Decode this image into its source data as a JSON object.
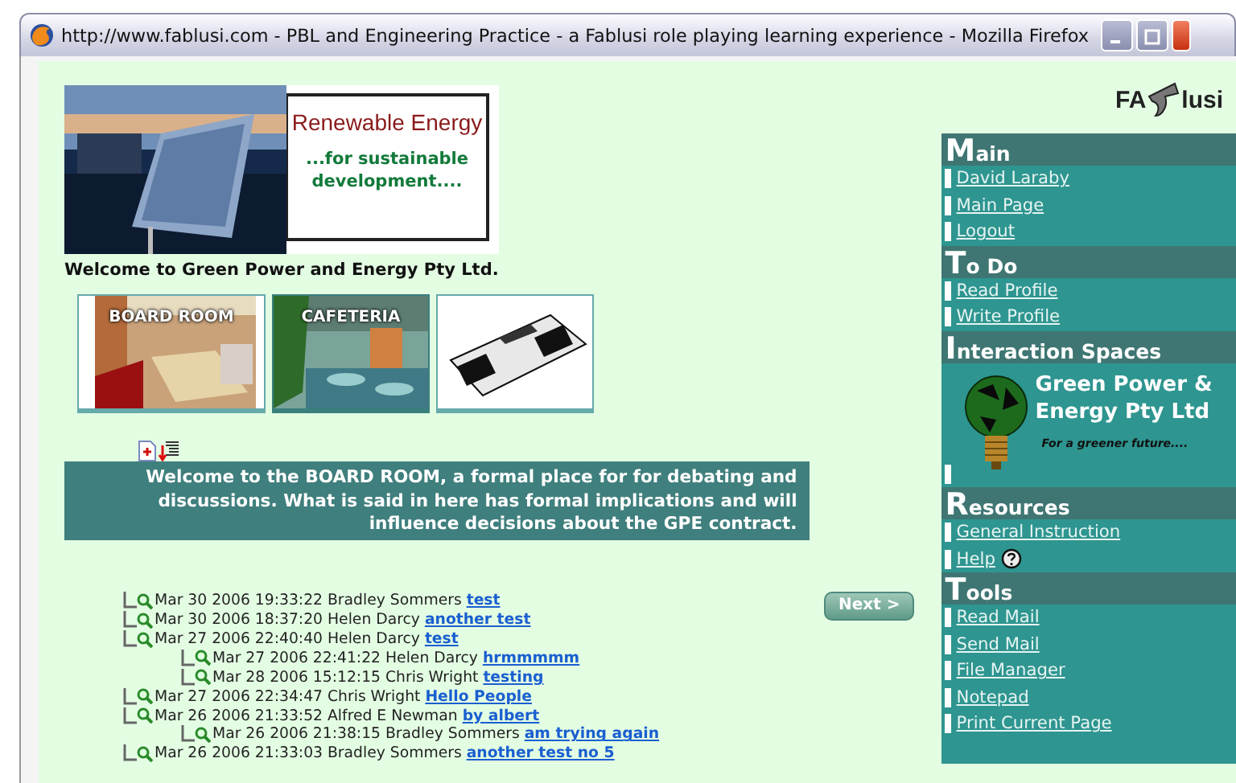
{
  "window": {
    "title": "http://www.fablusi.com - PBL and Engineering Practice - a Fablusi role playing learning experience - Mozilla Firefox"
  },
  "logo": {
    "left": "FA",
    "right": "lusi"
  },
  "banner": {
    "title": "Renewable Energy",
    "subtitle": "...for sustainable development...."
  },
  "welcome": "Welcome to Green Power and Energy Pty Ltd.",
  "rooms": [
    {
      "kind": "boardroom",
      "label": "BOARD ROOM",
      "selected": false
    },
    {
      "kind": "cafeteria",
      "label": "CAFETERIA",
      "selected": true
    },
    {
      "kind": "news",
      "selected": false
    }
  ],
  "room_description": "Welcome to the BOARD ROOM, a formal place for for debating and discussions. What is said in here has formal implications and will influence decisions about the GPE contract.",
  "next_button": "Next >",
  "posts": [
    {
      "date": "Mar 30 2006 19:33:22",
      "author": "Bradley Sommers",
      "subject": "test"
    },
    {
      "date": "Mar 30 2006 18:37:20",
      "author": "Helen Darcy",
      "subject": "another test"
    },
    {
      "date": "Mar 27 2006 22:40:40",
      "author": "Helen Darcy",
      "subject": "test",
      "children": [
        {
          "date": "Mar 27 2006 22:41:22",
          "author": "Helen Darcy",
          "subject": "hrmmmmm"
        },
        {
          "date": "Mar 28 2006 15:12:15",
          "author": "Chris Wright",
          "subject": "testing"
        }
      ]
    },
    {
      "date": "Mar 27 2006 22:34:47",
      "author": "Chris Wright",
      "subject": "Hello People"
    },
    {
      "date": "Mar 26 2006 21:33:52",
      "author": "Alfred E Newman",
      "subject": "by albert",
      "children": [
        {
          "date": "Mar 26 2006 21:38:15",
          "author": "Bradley Sommers",
          "subject": "am trying again"
        }
      ]
    },
    {
      "date": "Mar 26 2006 21:33:03",
      "author": "Bradley Sommers",
      "subject": "another test no 5"
    }
  ],
  "sidebar": [
    {
      "heading": "Main",
      "items": [
        {
          "label": "David Laraby"
        },
        {
          "label": "Main Page"
        },
        {
          "label": "Logout"
        }
      ]
    },
    {
      "heading": "To Do",
      "items": [
        {
          "label": "Read Profile"
        },
        {
          "label": "Write Profile"
        }
      ]
    },
    {
      "heading": "Interaction Spaces",
      "space": {
        "name": "Green Power & Energy Pty Ltd",
        "tagline": "For a greener future...."
      }
    },
    {
      "heading": "Resources",
      "items": [
        {
          "label": "General Instruction"
        },
        {
          "label": "Help",
          "help": true
        }
      ]
    },
    {
      "heading": "Tools",
      "items": [
        {
          "label": "Read Mail"
        },
        {
          "label": "Send Mail"
        },
        {
          "label": "File Manager"
        },
        {
          "label": "Notepad"
        },
        {
          "label": "Print Current Page"
        }
      ]
    }
  ]
}
